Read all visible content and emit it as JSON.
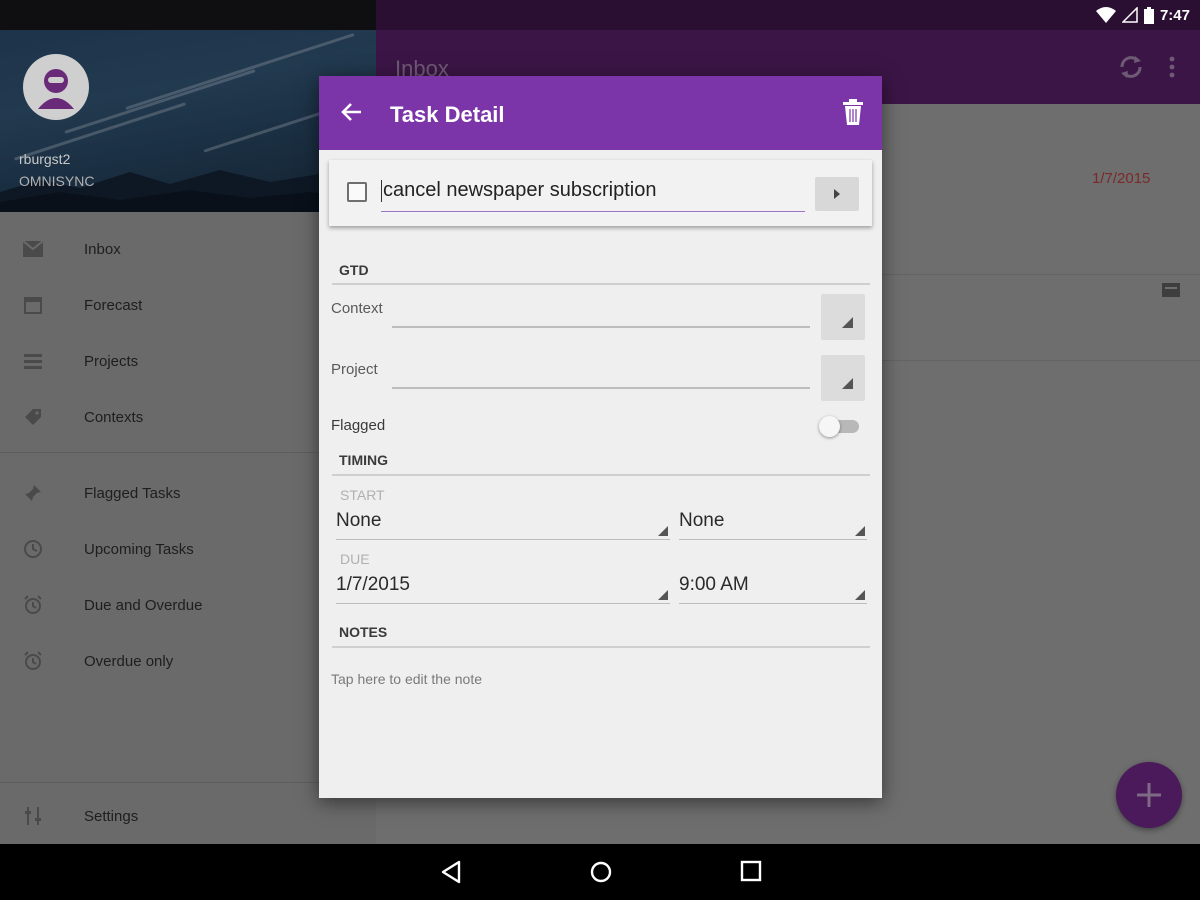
{
  "status_bar": {
    "time": "7:47"
  },
  "drawer": {
    "account_name": "rburgst2",
    "account_org": "OMNISYNC",
    "items": [
      {
        "label": "Inbox",
        "icon": "inbox-icon"
      },
      {
        "label": "Forecast",
        "icon": "calendar-icon"
      },
      {
        "label": "Projects",
        "icon": "list-icon"
      },
      {
        "label": "Contexts",
        "icon": "tag-icon"
      },
      {
        "label": "Flagged Tasks",
        "icon": "pin-icon"
      },
      {
        "label": "Upcoming Tasks",
        "icon": "clock-icon"
      },
      {
        "label": "Due and Overdue",
        "icon": "alarm-icon"
      },
      {
        "label": "Overdue only",
        "icon": "alarm-icon"
      }
    ],
    "settings_label": "Settings"
  },
  "main": {
    "title": "Inbox",
    "task_date": "1/7/2015"
  },
  "dialog": {
    "title": "Task Detail",
    "task_title": "cancel newspaper subscription",
    "task_completed": false,
    "gtd_header": "GTD",
    "context_label": "Context",
    "context_value": "",
    "project_label": "Project",
    "project_value": "",
    "flagged_label": "Flagged",
    "flagged": false,
    "timing_header": "TIMING",
    "start_label": "START",
    "start_date": "None",
    "start_time": "None",
    "due_label": "DUE",
    "due_date": "1/7/2015",
    "due_time": "9:00 AM",
    "notes_header": "NOTES",
    "notes_hint": "Tap here to edit the note"
  },
  "colors": {
    "accent": "#7b35a8",
    "overdue": "#7a2a28"
  }
}
